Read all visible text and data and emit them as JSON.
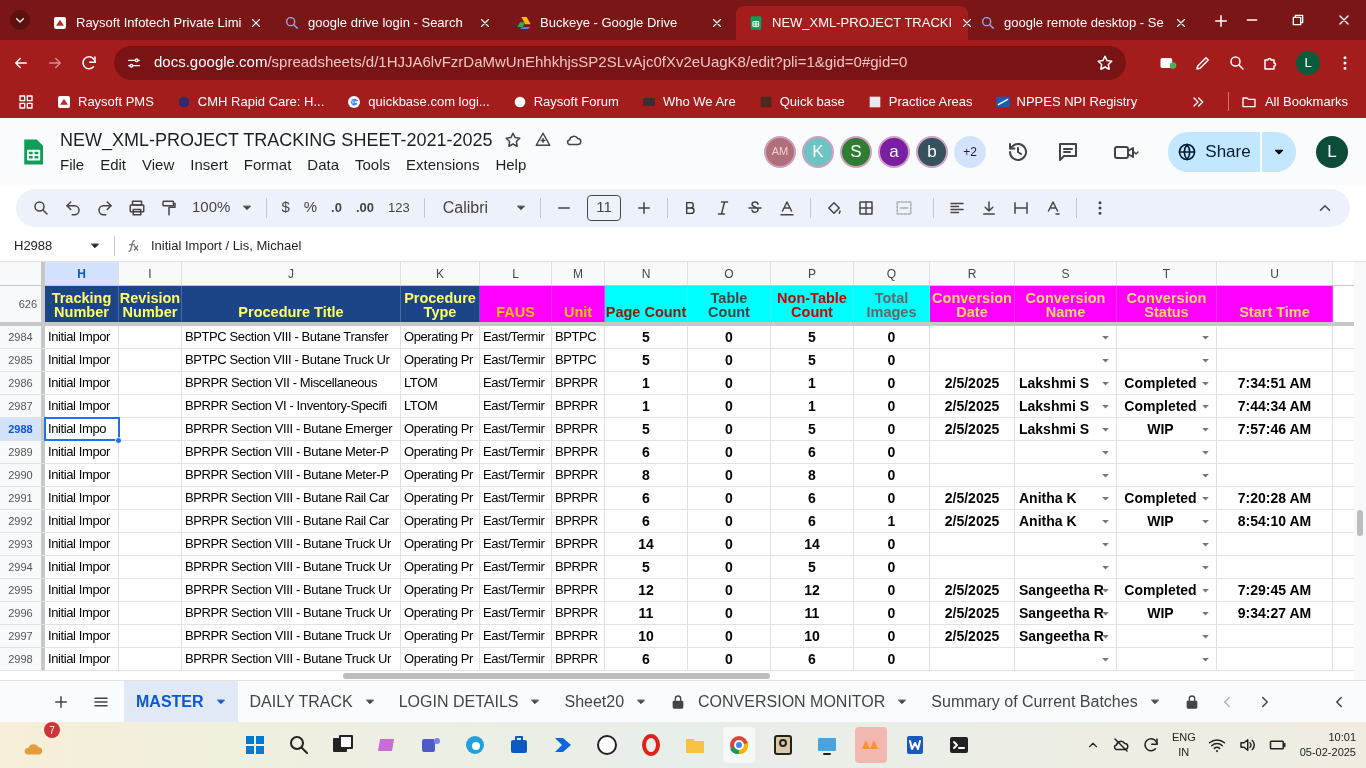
{
  "browser": {
    "tabs": [
      {
        "title": "Raysoft Infotech Private Limi",
        "selected": false
      },
      {
        "title": "google drive login - Search",
        "selected": false
      },
      {
        "title": "Buckeye - Google Drive",
        "selected": false
      },
      {
        "title": "NEW_XML-PROJECT TRACKI",
        "selected": true
      },
      {
        "title": "google remote desktop - Se",
        "selected": false
      }
    ],
    "url_host": "docs.google.com",
    "url_path": "/spreadsheets/d/1HJJA6lvFzrDaMwUnEhhkhjsSP2SLvAjc0fXv2eUagK8/edit?pli=1&gid=0#gid=0",
    "bookmarks": [
      "Raysoft PMS",
      "CMH Rapid Care: H...",
      "quickbase.com logi...",
      "Raysoft Forum",
      "Who We Are",
      "Quick base",
      "Practice Areas",
      "NPPES NPI Registry"
    ],
    "all_bookmarks": "All Bookmarks",
    "profile": "L"
  },
  "sheet": {
    "title": "NEW_XML-PROJECT TRACKING SHEET-2021-2025",
    "menu": [
      "File",
      "Edit",
      "View",
      "Insert",
      "Format",
      "Data",
      "Tools",
      "Extensions",
      "Help"
    ],
    "collaborators": [
      {
        "initials": "AM",
        "color": "#b0707a"
      },
      {
        "initials": "K",
        "color": "#6cc4c4"
      },
      {
        "initials": "S",
        "color": "#2e7d32"
      },
      {
        "initials": "a",
        "color": "#7b1fa2"
      },
      {
        "initials": "b",
        "color": "#37525f"
      }
    ],
    "more_collaborators": "+2",
    "share": "Share",
    "account": "L",
    "toolbar": {
      "zoom": "100%",
      "currency": "$",
      "percent": "%",
      "decimal_less": ".0",
      "decimal_more": ".00",
      "number_format": "123",
      "font": "Calibri",
      "font_size": "11"
    },
    "cell_ref": "H2988",
    "formula": "Initial Import / Lis, Michael",
    "row_count": "626",
    "columns": [
      {
        "letter": "H",
        "header": {
          "text": "Tracking Number",
          "color": "#ffff66"
        },
        "color": "#1c4587",
        "kind": "text",
        "selected": true
      },
      {
        "letter": "I",
        "header": {
          "text": "Revision Number",
          "color": "#ffff66"
        },
        "color": "#1c4587",
        "kind": "text",
        "selected": false
      },
      {
        "letter": "J",
        "header": {
          "text": "Procedure Title",
          "color": "#ffff66"
        },
        "color": "#1c4587",
        "kind": "text",
        "selected": false
      },
      {
        "letter": "K",
        "header": {
          "text": "Procedure Type",
          "color": "#ffff66"
        },
        "color": "#1c4587",
        "kind": "text",
        "selected": false
      },
      {
        "letter": "L",
        "header": {
          "text": "FAUS",
          "color": "#ffc000"
        },
        "color": "#ff00ff",
        "kind": "text",
        "selected": false
      },
      {
        "letter": "M",
        "header": {
          "text": "Unit",
          "color": "#ffc000"
        },
        "color": "#ff00ff",
        "kind": "text",
        "selected": false
      },
      {
        "letter": "N",
        "header": {
          "text": "Page Count",
          "color": "#85200c"
        },
        "color": "#00ffff",
        "kind": "count",
        "selected": false
      },
      {
        "letter": "O",
        "header": {
          "text": "Table Count",
          "color": "#434343"
        },
        "color": "#00ffff",
        "kind": "count",
        "selected": false
      },
      {
        "letter": "P",
        "header": {
          "text": "Non-Table Count",
          "color": "#cc0000"
        },
        "color": "#00ffff",
        "kind": "count",
        "selected": false
      },
      {
        "letter": "Q",
        "header": {
          "text": "Total Images",
          "color": "#666666"
        },
        "color": "#00ffff",
        "kind": "count",
        "selected": false
      },
      {
        "letter": "R",
        "header": {
          "text": "Conversion Date",
          "color": "#ffd966"
        },
        "color": "#ff00ff",
        "kind": "count",
        "selected": false
      },
      {
        "letter": "S",
        "header": {
          "text": "Conversion Name",
          "color": "#ffd966"
        },
        "color": "#ff00ff",
        "kind": "picker",
        "selected": false
      },
      {
        "letter": "T",
        "header": {
          "text": "Conversion Status",
          "color": "#ffd966"
        },
        "color": "#ff00ff",
        "kind": "status",
        "selected": false
      },
      {
        "letter": "U",
        "header": {
          "text": "Start Time",
          "color": "#ffd966"
        },
        "color": "#ff00ff",
        "kind": "count",
        "selected": false
      }
    ],
    "rows": [
      {
        "number": "2984",
        "selected": false,
        "cells": [
          "Initial Impor",
          "",
          "BPTPC Section VIII - Butane Transfer",
          "Operating Pr",
          "East/Termir",
          "BPTPC",
          "5",
          "0",
          "5",
          "0",
          "",
          "",
          "",
          ""
        ]
      },
      {
        "number": "2985",
        "selected": false,
        "cells": [
          "Initial Impor",
          "",
          "BPTPC Section VIII - Butane Truck Ur",
          "Operating Pr",
          "East/Termir",
          "BPTPC",
          "5",
          "0",
          "5",
          "0",
          "",
          "",
          "",
          ""
        ]
      },
      {
        "number": "2986",
        "selected": false,
        "cells": [
          "Initial Impor",
          "",
          "BPRPR Section VII - Miscellaneous",
          "LTOM",
          "East/Termir",
          "BPRPR",
          "1",
          "0",
          "1",
          "0",
          "2/5/2025",
          "Lakshmi S",
          "Completed",
          "7:34:51 AM"
        ]
      },
      {
        "number": "2987",
        "selected": false,
        "cells": [
          "Initial Impor",
          "",
          "BPRPR Section VI - Inventory-Specifi",
          "LTOM",
          "East/Termir",
          "BPRPR",
          "1",
          "0",
          "1",
          "0",
          "2/5/2025",
          "Lakshmi S",
          "Completed",
          "7:44:34 AM"
        ]
      },
      {
        "number": "2988",
        "selected": true,
        "cells": [
          "Initial Impo",
          "",
          "BPRPR Section VIII - Butane Emerger",
          "Operating Pr",
          "East/Termir",
          "BPRPR",
          "5",
          "0",
          "5",
          "0",
          "2/5/2025",
          "Lakshmi S",
          "WIP",
          "7:57:46 AM"
        ]
      },
      {
        "number": "2989",
        "selected": false,
        "cells": [
          "Initial Impor",
          "",
          "BPRPR Section VIII - Butane Meter-P",
          "Operating Pr",
          "East/Termir",
          "BPRPR",
          "6",
          "0",
          "6",
          "0",
          "",
          "",
          "",
          ""
        ]
      },
      {
        "number": "2990",
        "selected": false,
        "cells": [
          "Initial Impor",
          "",
          "BPRPR Section VIII - Butane Meter-P",
          "Operating Pr",
          "East/Termir",
          "BPRPR",
          "8",
          "0",
          "8",
          "0",
          "",
          "",
          "",
          ""
        ]
      },
      {
        "number": "2991",
        "selected": false,
        "cells": [
          "Initial Impor",
          "",
          "BPRPR Section VIII - Butane Rail Car",
          "Operating Pr",
          "East/Termir",
          "BPRPR",
          "6",
          "0",
          "6",
          "0",
          "2/5/2025",
          "Anitha K",
          "Completed",
          "7:20:28 AM"
        ]
      },
      {
        "number": "2992",
        "selected": false,
        "cells": [
          "Initial Impor",
          "",
          "BPRPR Section VIII - Butane Rail Car",
          "Operating Pr",
          "East/Termir",
          "BPRPR",
          "6",
          "0",
          "6",
          "1",
          "2/5/2025",
          "Anitha K",
          "WIP",
          "8:54:10 AM"
        ]
      },
      {
        "number": "2993",
        "selected": false,
        "cells": [
          "Initial Impor",
          "",
          "BPRPR Section VIII - Butane Truck Ur",
          "Operating Pr",
          "East/Termir",
          "BPRPR",
          "14",
          "0",
          "14",
          "0",
          "",
          "",
          "",
          ""
        ]
      },
      {
        "number": "2994",
        "selected": false,
        "cells": [
          "Initial Impor",
          "",
          "BPRPR Section VIII - Butane Truck Ur",
          "Operating Pr",
          "East/Termir",
          "BPRPR",
          "5",
          "0",
          "5",
          "0",
          "",
          "",
          "",
          ""
        ]
      },
      {
        "number": "2995",
        "selected": false,
        "cells": [
          "Initial Impor",
          "",
          "BPRPR Section VIII - Butane Truck Ur",
          "Operating Pr",
          "East/Termir",
          "BPRPR",
          "12",
          "0",
          "12",
          "0",
          "2/5/2025",
          "Sangeetha R",
          "Completed",
          "7:29:45 AM"
        ]
      },
      {
        "number": "2996",
        "selected": false,
        "cells": [
          "Initial Impor",
          "",
          "BPRPR Section VIII - Butane Truck Ur",
          "Operating Pr",
          "East/Termir",
          "BPRPR",
          "11",
          "0",
          "11",
          "0",
          "2/5/2025",
          "Sangeetha R",
          "WIP",
          "9:34:27 AM"
        ]
      },
      {
        "number": "2997",
        "selected": false,
        "cells": [
          "Initial Impor",
          "",
          "BPRPR Section VIII - Butane Truck Ur",
          "Operating Pr",
          "East/Termir",
          "BPRPR",
          "10",
          "0",
          "10",
          "0",
          "2/5/2025",
          "Sangeetha R",
          "",
          ""
        ]
      },
      {
        "number": "2998",
        "selected": false,
        "cells": [
          "Initial Impor",
          "",
          "BPRPR Section VIII - Butane Truck Ur",
          "Operating Pr",
          "East/Termir",
          "BPRPR",
          "6",
          "0",
          "6",
          "0",
          "",
          "",
          "",
          ""
        ]
      }
    ],
    "sheet_tabs": [
      {
        "label": "MASTER",
        "selected": true,
        "locked": false
      },
      {
        "label": "DAILY TRACK",
        "selected": false,
        "locked": false
      },
      {
        "label": "LOGIN DETAILS",
        "selected": false,
        "locked": false
      },
      {
        "label": "Sheet20",
        "selected": false,
        "locked": false
      },
      {
        "label": "CONVERSION MONITOR",
        "selected": false,
        "locked": true
      },
      {
        "label": "Summary of Current Batches",
        "selected": false,
        "locked": false
      }
    ]
  },
  "taskbar": {
    "weather_badge": "7",
    "language": "ENG",
    "region": "IN",
    "time": "10:01",
    "date": "05-02-2025"
  }
}
